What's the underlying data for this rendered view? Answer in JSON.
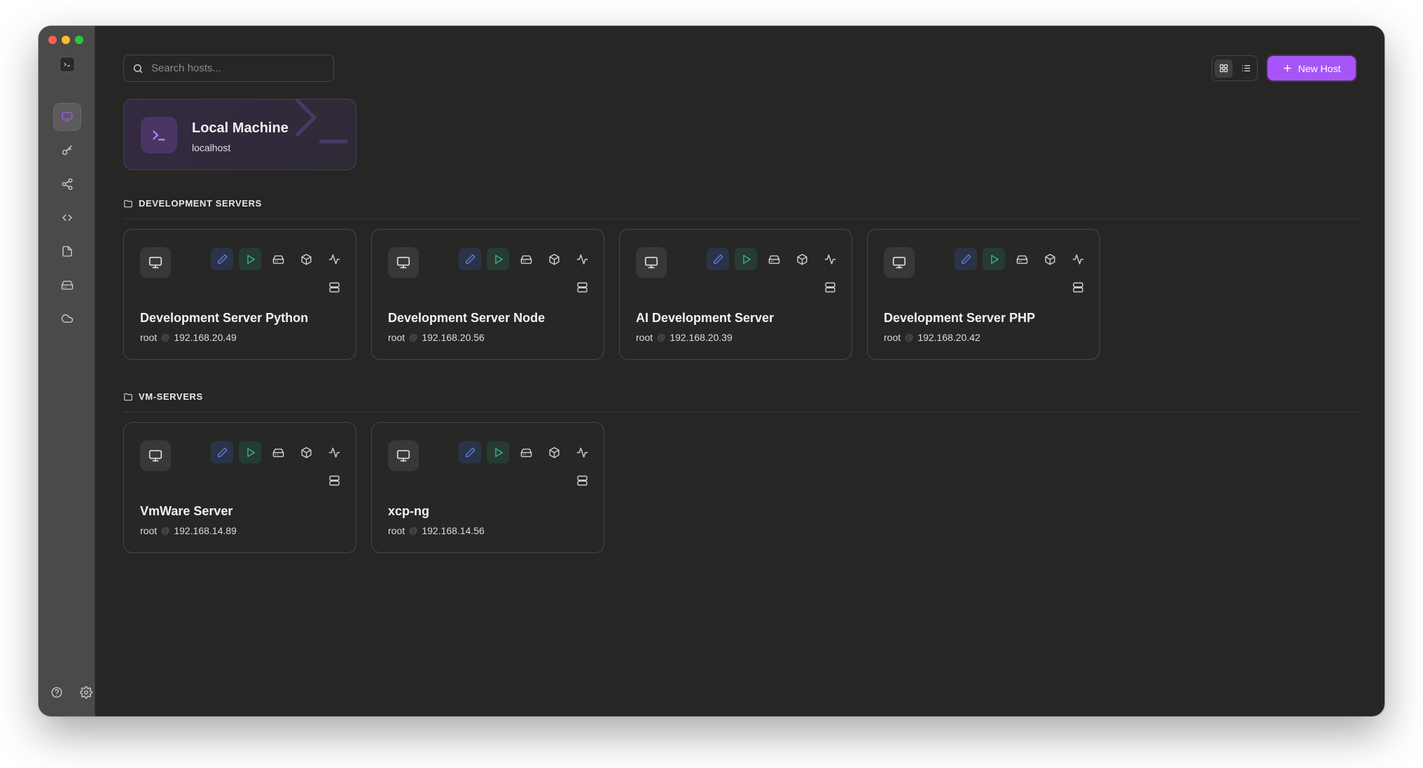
{
  "colors": {
    "accent": "#a855f7",
    "edit": "#5b7fd6",
    "run": "#3fb37f",
    "muted_icon": "#d0d0d0"
  },
  "window": {
    "traffic_lights": [
      "#ff5f57",
      "#febc2e",
      "#28c840"
    ]
  },
  "sidebar": {
    "items": [
      {
        "icon": "monitor-icon",
        "active": true
      },
      {
        "icon": "key-icon",
        "active": false
      },
      {
        "icon": "share-icon",
        "active": false
      },
      {
        "icon": "code-icon",
        "active": false
      },
      {
        "icon": "file-icon",
        "active": false
      },
      {
        "icon": "hard-drive-icon",
        "active": false
      },
      {
        "icon": "cloud-icon",
        "active": false
      }
    ],
    "bottom": [
      {
        "icon": "help-icon"
      },
      {
        "icon": "gear-icon"
      }
    ]
  },
  "toolbar": {
    "search_placeholder": "Search hosts...",
    "new_host_label": "New Host",
    "view_modes": [
      "grid",
      "list"
    ],
    "active_view": "grid"
  },
  "local": {
    "title": "Local Machine",
    "subtitle": "localhost"
  },
  "groups": [
    {
      "name": "DEVELOPMENT SERVERS",
      "hosts": [
        {
          "name": "Development Server Python",
          "user": "root",
          "at": "@",
          "ip": "192.168.20.49"
        },
        {
          "name": "Development Server Node",
          "user": "root",
          "at": "@",
          "ip": "192.168.20.56"
        },
        {
          "name": "AI Development Server",
          "user": "root",
          "at": "@",
          "ip": "192.168.20.39"
        },
        {
          "name": "Development Server PHP",
          "user": "root",
          "at": "@",
          "ip": "192.168.20.42"
        }
      ]
    },
    {
      "name": "VM-SERVERS",
      "hosts": [
        {
          "name": "VmWare Server",
          "user": "root",
          "at": "@",
          "ip": "192.168.14.89"
        },
        {
          "name": "xcp-ng",
          "user": "root",
          "at": "@",
          "ip": "192.168.14.56"
        }
      ]
    }
  ]
}
